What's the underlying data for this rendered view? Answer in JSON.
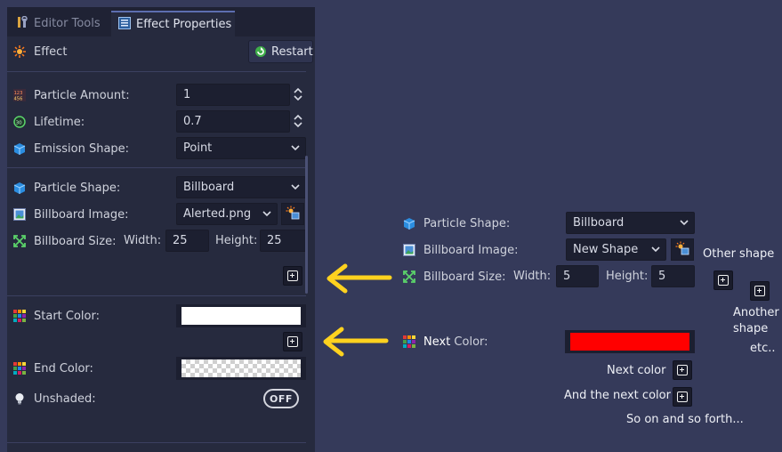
{
  "tabs": [
    {
      "label": "Editor Tools",
      "icon": "tools-icon"
    },
    {
      "label": "Effect Properties",
      "icon": "properties-icon"
    }
  ],
  "effect": {
    "label": "Effect",
    "restart_label": "Restart"
  },
  "props": {
    "particle_amount": {
      "label": "Particle Amount:",
      "value": "1"
    },
    "lifetime": {
      "label": "Lifetime:",
      "value": "0.7"
    },
    "emission_shape": {
      "label": "Emission Shape:",
      "value": "Point"
    },
    "particle_shape": {
      "label": "Particle Shape:",
      "value": "Billboard"
    },
    "billboard_image": {
      "label": "Billboard Image:",
      "value": "Alerted.png"
    },
    "billboard_size": {
      "label": "Billboard Size:",
      "width_label": "Width:",
      "width_value": "25",
      "height_label": "Height:",
      "height_value": "25"
    },
    "start_color": {
      "label": "Start Color:",
      "value": "#ffffff"
    },
    "end_color": {
      "label": "End Color:",
      "value": "transparent"
    },
    "unshaded": {
      "label": "Unshaded:",
      "toggle": "OFF"
    }
  },
  "mockup": {
    "particle_shape": {
      "label": "Particle Shape:",
      "value": "Billboard"
    },
    "billboard_image": {
      "label": "Billboard Image:",
      "value": "New Shape"
    },
    "billboard_size": {
      "label": "Billboard Size:",
      "width_label": "Width:",
      "width_value": "5",
      "height_label": "Height:",
      "height_value": "5"
    },
    "next_color": {
      "label_bold": "Next",
      "label_rest": " Color:",
      "value": "#ff0000"
    },
    "notes": {
      "other_shape": "Other shape",
      "another_shape_1": "Another",
      "another_shape_2": "shape",
      "etc": "etc..",
      "next_color": "Next color",
      "and_next_color": "And the next color",
      "so_on": "So on and so forth..."
    }
  },
  "colors": {
    "arrow": "#ffd21f",
    "panel": "#262a3e",
    "background": "#353a5a"
  }
}
